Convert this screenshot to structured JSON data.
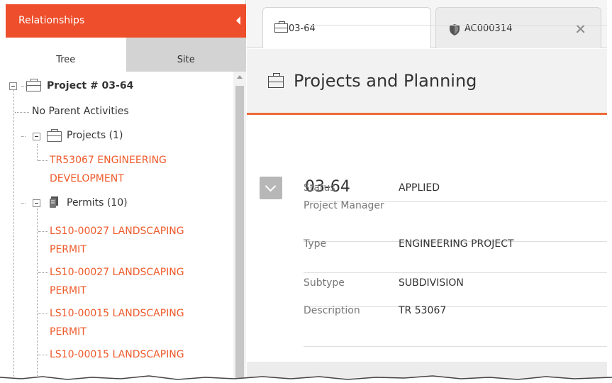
{
  "relationships": {
    "title": "Relationships",
    "tabs": [
      "Tree",
      "Site"
    ],
    "tree": {
      "root": "Project # 03-64",
      "no_parent": "No Parent Activities",
      "projects_group": "Projects (1)",
      "projects": [
        "TR53067 ENGINEERING",
        "DEVELOPMENT"
      ],
      "permits_group": "Permits (10)",
      "permits": [
        "LS10-00027 LANDSCAPING",
        "PERMIT",
        "LS10-00027 LANDSCAPING",
        "PERMIT",
        "LS10-00015 LANDSCAPING",
        "PERMIT",
        "LS10-00015 LANDSCAPING"
      ]
    }
  },
  "doc_tabs": [
    {
      "label": "03-64",
      "icon": "briefcase-icon"
    },
    {
      "label": "AC000314",
      "icon": "shield-icon",
      "close": "✕"
    }
  ],
  "page": {
    "title": "Projects and Planning",
    "record_id": "03-64",
    "fields": [
      {
        "label": "Status",
        "value": "APPLIED"
      },
      {
        "label": "Project Manager",
        "value": ""
      },
      {
        "label": "Type",
        "value": "ENGINEERING PROJECT"
      },
      {
        "label": "Subtype",
        "value": "SUBDIVISION"
      },
      {
        "label": "Description",
        "value": "TR 53067"
      }
    ]
  },
  "colors": {
    "accent": "#ee4e2b",
    "link": "#ee5a2a"
  }
}
